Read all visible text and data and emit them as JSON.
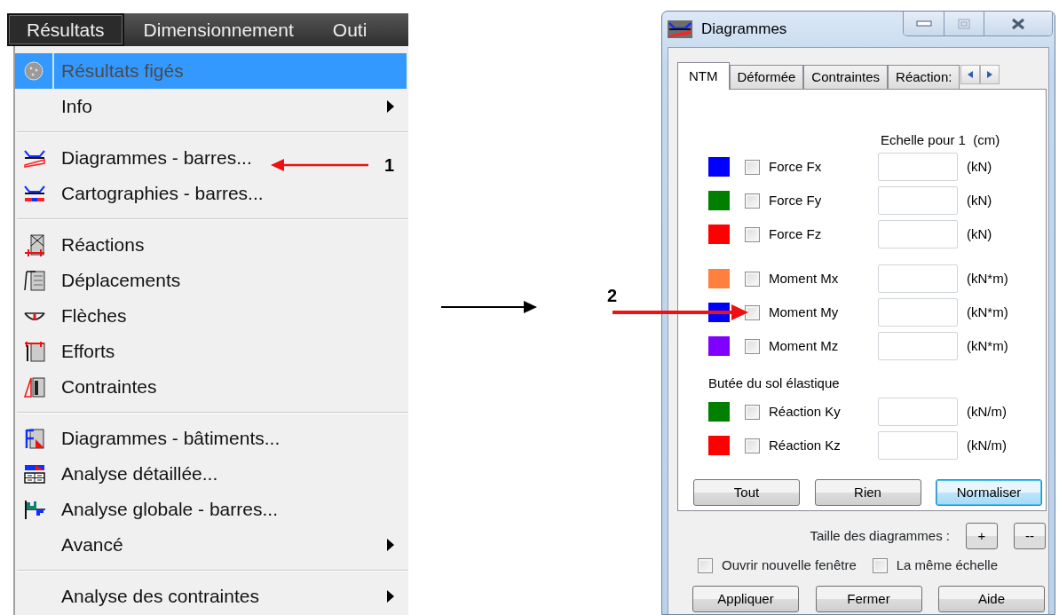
{
  "menu_bar": [
    {
      "label": "Résultats",
      "selected": true
    },
    {
      "label": "Dimensionnement",
      "selected": false
    },
    {
      "label": "Outi",
      "selected": false
    }
  ],
  "menu": [
    {
      "kind": "item",
      "label": "Résultats figés",
      "disabled": true,
      "selected": true,
      "submenu": false
    },
    {
      "kind": "item",
      "label": "Info",
      "disabled": false,
      "selected": false,
      "submenu": true
    },
    {
      "kind": "separator"
    },
    {
      "kind": "item",
      "label": "Diagrammes - barres...",
      "disabled": false,
      "selected": false,
      "submenu": false
    },
    {
      "kind": "item",
      "label": "Cartographies - barres...",
      "disabled": false,
      "selected": false,
      "submenu": false
    },
    {
      "kind": "separator"
    },
    {
      "kind": "item",
      "label": "Réactions",
      "disabled": false,
      "selected": false,
      "submenu": false
    },
    {
      "kind": "item",
      "label": "Déplacements",
      "disabled": false,
      "selected": false,
      "submenu": false
    },
    {
      "kind": "item",
      "label": "Flèches",
      "disabled": false,
      "selected": false,
      "submenu": false
    },
    {
      "kind": "item",
      "label": "Efforts",
      "disabled": false,
      "selected": false,
      "submenu": false
    },
    {
      "kind": "item",
      "label": "Contraintes",
      "disabled": false,
      "selected": false,
      "submenu": false
    },
    {
      "kind": "separator"
    },
    {
      "kind": "item",
      "label": "Diagrammes - bâtiments...",
      "disabled": false,
      "selected": false,
      "submenu": false
    },
    {
      "kind": "item",
      "label": "Analyse détaillée...",
      "disabled": false,
      "selected": false,
      "submenu": false
    },
    {
      "kind": "item",
      "label": "Analyse globale - barres...",
      "disabled": false,
      "selected": false,
      "submenu": false
    },
    {
      "kind": "item",
      "label": "Avancé",
      "disabled": false,
      "selected": false,
      "submenu": true
    },
    {
      "kind": "separator"
    },
    {
      "kind": "item",
      "label": "Analyse des contraintes",
      "disabled": false,
      "selected": false,
      "submenu": true
    }
  ],
  "callouts": [
    "1",
    "2"
  ],
  "dialog": {
    "title": "Diagrammes",
    "tabs": [
      {
        "label": "NTM",
        "selected": true
      },
      {
        "label": "Déformée",
        "selected": false
      },
      {
        "label": "Contraintes",
        "selected": false
      },
      {
        "label": "Réaction:",
        "selected": false
      }
    ],
    "scale_header": "Echelle pour 1  (cm)",
    "sections": [
      {
        "rows": [
          {
            "label": "Force Fx",
            "color": "#0000ff",
            "checked": false,
            "unit": "(kN)"
          },
          {
            "label": "Force Fy",
            "color": "#007f00",
            "checked": false,
            "unit": "(kN)"
          },
          {
            "label": "Force Fz",
            "color": "#ff0000",
            "checked": false,
            "unit": "(kN)"
          }
        ]
      },
      {
        "rows": [
          {
            "label": "Moment Mx",
            "color": "#ff7f3f",
            "checked": false,
            "unit": "(kN*m)"
          },
          {
            "label": "Moment My",
            "color": "#0000ff",
            "checked": false,
            "unit": "(kN*m)"
          },
          {
            "label": "Moment Mz",
            "color": "#7f00ff",
            "checked": false,
            "unit": "(kN*m)"
          }
        ]
      },
      {
        "title": "Butée du sol élastique",
        "rows": [
          {
            "label": "Réaction Ky",
            "color": "#007f00",
            "checked": false,
            "unit": "(kN/m)"
          },
          {
            "label": "Réaction Kz",
            "color": "#ff0000",
            "checked": false,
            "unit": "(kN/m)"
          }
        ]
      }
    ],
    "panel_buttons": [
      {
        "label": "Tout",
        "default": false
      },
      {
        "label": "Rien",
        "default": false
      },
      {
        "label": "Normaliser",
        "default": true
      }
    ],
    "size_label": "Taille des diagrammes :",
    "size_buttons": [
      "+",
      "--"
    ],
    "options": [
      {
        "label": "Ouvrir nouvelle fenêtre",
        "checked": false
      },
      {
        "label": "La même échelle",
        "checked": false
      }
    ],
    "footer_buttons": [
      "Appliquer",
      "Fermer",
      "Aide"
    ]
  }
}
